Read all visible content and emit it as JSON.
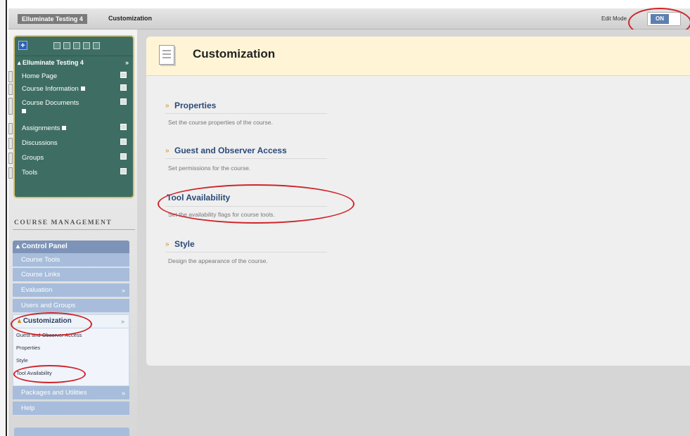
{
  "topbar": {
    "course_crumb": "Elluminate Testing 4",
    "current_crumb": "Customization",
    "edit_mode_label": "Edit Mode",
    "edit_mode_state": "ON"
  },
  "course_menu": {
    "course_title": "Elluminate Testing 4",
    "items": [
      {
        "label": "Home Page"
      },
      {
        "label": "Course Information"
      },
      {
        "label": "Course Documents"
      },
      {
        "label": "Assignments"
      },
      {
        "label": "Discussions"
      },
      {
        "label": "Groups"
      },
      {
        "label": "Tools"
      }
    ]
  },
  "course_management": {
    "heading": "COURSE MANAGEMENT",
    "control_panel": "Control Panel",
    "items": [
      {
        "label": "Course Tools"
      },
      {
        "label": "Course Links"
      },
      {
        "label": "Evaluation"
      },
      {
        "label": "Users and Groups"
      }
    ],
    "active": "Customization",
    "sub_items": [
      {
        "label": "Guest and Observer Access"
      },
      {
        "label": "Properties"
      },
      {
        "label": "Style"
      },
      {
        "label": "Tool Availability"
      }
    ],
    "after_items": [
      {
        "label": "Packages and Utilities"
      },
      {
        "label": "Help"
      }
    ]
  },
  "page": {
    "title": "Customization",
    "options": [
      {
        "title": "Properties",
        "desc": "Set the course properties of the course."
      },
      {
        "title": "Guest and Observer Access",
        "desc": "Set permissions for the course."
      },
      {
        "title": "Tool Availability",
        "desc": "Set the availability flags for course tools."
      },
      {
        "title": "Style",
        "desc": "Design the appearance of the course."
      }
    ]
  },
  "colors": {
    "annotation_red": "#d0242a",
    "course_menu_green": "#3e6e63",
    "control_panel_blue": "#a7bddb",
    "header_yellow": "#fff5d6"
  }
}
